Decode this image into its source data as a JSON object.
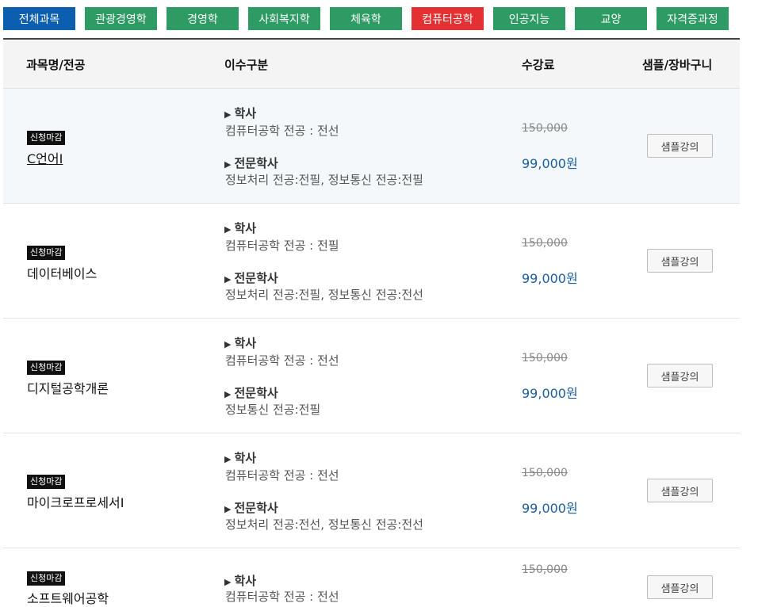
{
  "tabs": [
    {
      "label": "전체과목"
    },
    {
      "label": "관광경영학"
    },
    {
      "label": "경영학"
    },
    {
      "label": "사회복지학"
    },
    {
      "label": "체육학"
    },
    {
      "label": "컴퓨터공학"
    },
    {
      "label": "인공지능"
    },
    {
      "label": "교양"
    },
    {
      "label": "자격증과정"
    }
  ],
  "active_tab": "전체과목",
  "highlight_tab": "컴퓨터공학",
  "header": {
    "course": "과목명/전공",
    "division": "이수구분",
    "fee": "수강료",
    "sample": "샘플/장바구니"
  },
  "courses": [
    {
      "badge": "신청마감",
      "name": "C언어Ⅰ",
      "bachelor_label": "학사",
      "bachelor_text": "컴퓨터공학 전공 : 전선",
      "assoc_label": "전문학사",
      "assoc_text": "정보처리 전공:전필, 정보통신 전공:전필",
      "original_price": "150,000",
      "price": "99,000원",
      "sample_label": "샘플강의"
    },
    {
      "badge": "신청마감",
      "name": "데이터베이스",
      "bachelor_label": "학사",
      "bachelor_text": "컴퓨터공학 전공 : 전필",
      "assoc_label": "전문학사",
      "assoc_text": "정보처리 전공:전필, 정보통신 전공:전선",
      "original_price": "150,000",
      "price": "99,000원",
      "sample_label": "샘플강의"
    },
    {
      "badge": "신청마감",
      "name": "디지털공학개론",
      "bachelor_label": "학사",
      "bachelor_text": "컴퓨터공학 전공 : 전선",
      "assoc_label": "전문학사",
      "assoc_text": "정보통신 전공:전필",
      "original_price": "150,000",
      "price": "99,000원",
      "sample_label": "샘플강의"
    },
    {
      "badge": "신청마감",
      "name": "마이크로프로세서Ⅰ",
      "bachelor_label": "학사",
      "bachelor_text": "컴퓨터공학 전공 : 전선",
      "assoc_label": "전문학사",
      "assoc_text": "정보처리 전공:전선, 정보통신 전공:전선",
      "original_price": "150,000",
      "price": "99,000원",
      "sample_label": "샘플강의"
    },
    {
      "badge": "신청마감",
      "name": "소프트웨어공학",
      "bachelor_label": "학사",
      "bachelor_text": "컴퓨터공학 전공 : 전선",
      "original_price": "150,000",
      "sample_label": "샘플강의"
    }
  ]
}
